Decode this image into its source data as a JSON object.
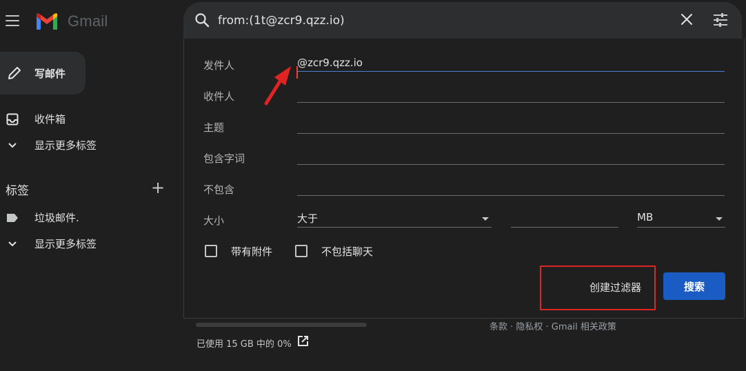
{
  "app": {
    "name": "Gmail"
  },
  "icons": {
    "menu": "hamburger-icon",
    "compose": "pencil-icon",
    "inbox": "inbox-icon",
    "expand": "chevron-down-icon",
    "label": "label-tag-icon",
    "add": "plus-icon",
    "search": "search-icon",
    "clear": "close-icon",
    "options": "tune-icon",
    "external": "open-in-new-icon"
  },
  "sidebar": {
    "compose_label": "写邮件",
    "inbox_label": "收件箱",
    "more_labels_1": "显示更多标签",
    "labels_heading": "标签",
    "add_label": "+",
    "spam_label": "垃圾邮件.",
    "more_labels_2": "显示更多标签"
  },
  "search": {
    "query": "from:(1t@zcr9.qzz.io)"
  },
  "advanced": {
    "from_label": "发件人",
    "from_value": "@zcr9.qzz.io",
    "to_label": "收件人",
    "subject_label": "主题",
    "has_words_label": "包含字词",
    "exclude_label": "不包含",
    "size_label": "大小",
    "size_compare": "大于",
    "size_unit": "MB",
    "has_attachment_label": "带有附件",
    "exclude_chats_label": "不包括聊天",
    "create_filter_label": "创建过滤器",
    "search_button_label": "搜索"
  },
  "footer": {
    "storage_text": "已使用 15 GB 中的 0%",
    "storage_used_fraction": 0,
    "links": "条款 · 隐私权 · Gmail 相关政策"
  },
  "colors": {
    "background": "#1f1f1f",
    "primary_button": "#1a5bc4",
    "annotation_red": "#e02424",
    "gmail_red": "#ea4335",
    "gmail_blue": "#4285f4",
    "gmail_green": "#34a853",
    "gmail_yellow": "#fbbc04"
  }
}
